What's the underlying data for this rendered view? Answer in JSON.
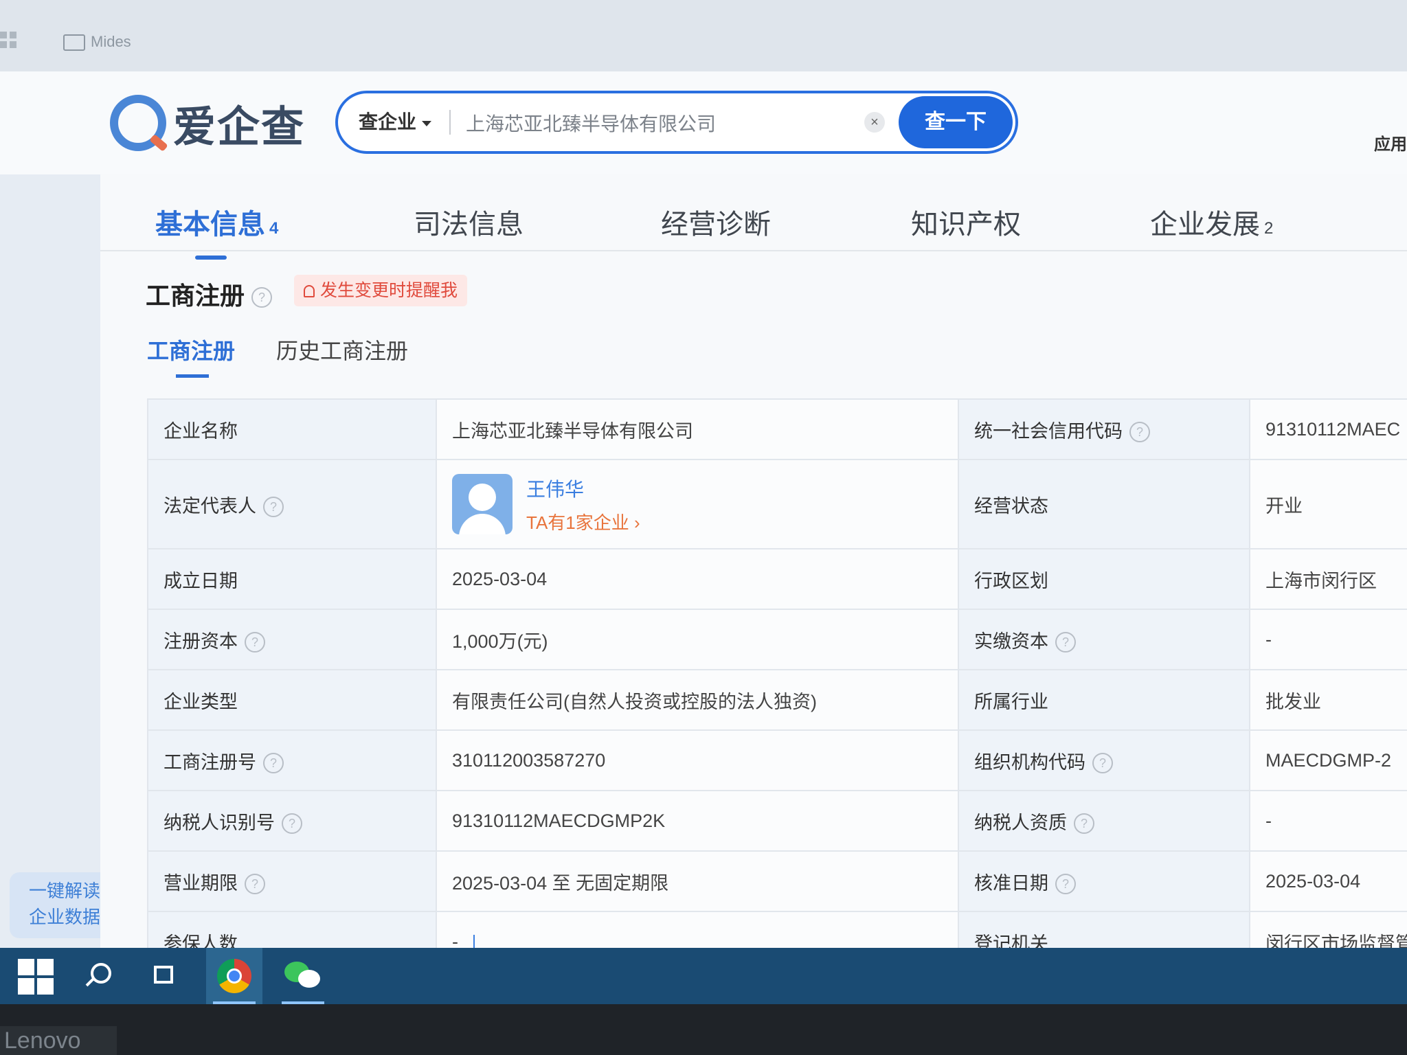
{
  "browser": {
    "bookmark_label": "Mides"
  },
  "header": {
    "logo_text": "爱企查",
    "search_type": "查企业",
    "search_value": "上海芯亚北臻半导体有限公司",
    "search_button": "查一下",
    "apply_label": "应用"
  },
  "tabs": [
    {
      "label": "基本信息",
      "count": "4"
    },
    {
      "label": "司法信息",
      "count": ""
    },
    {
      "label": "经营诊断",
      "count": ""
    },
    {
      "label": "知识产权",
      "count": ""
    },
    {
      "label": "企业发展",
      "count": "2"
    }
  ],
  "section": {
    "title": "工商注册",
    "remind": "发生变更时提醒我",
    "subtabs": [
      "工商注册",
      "历史工商注册"
    ]
  },
  "table": {
    "company_name": {
      "label": "企业名称",
      "value": "上海芯亚北臻半导体有限公司"
    },
    "credit_code": {
      "label": "统一社会信用代码",
      "value": "91310112MAEC"
    },
    "legal_rep": {
      "label": "法定代表人",
      "name": "王伟华",
      "count_text": "TA有1家企业 ›"
    },
    "status": {
      "label": "经营状态",
      "value": "开业"
    },
    "founded": {
      "label": "成立日期",
      "value": "2025-03-04"
    },
    "region": {
      "label": "行政区划",
      "value": "上海市闵行区"
    },
    "reg_capital": {
      "label": "注册资本",
      "value": "1,000万(元)"
    },
    "paid_capital": {
      "label": "实缴资本",
      "value": "-"
    },
    "company_type": {
      "label": "企业类型",
      "value": "有限责任公司(自然人投资或控股的法人独资)"
    },
    "industry": {
      "label": "所属行业",
      "value": "批发业"
    },
    "reg_number": {
      "label": "工商注册号",
      "value": "310112003587270"
    },
    "org_code": {
      "label": "组织机构代码",
      "value": "MAECDGMP-2"
    },
    "taxpayer_id": {
      "label": "纳税人识别号",
      "value": "91310112MAECDGMP2K"
    },
    "taxpayer_qual": {
      "label": "纳税人资质",
      "value": "-"
    },
    "term": {
      "label": "营业期限",
      "value": "2025-03-04 至 无固定期限"
    },
    "approval_date": {
      "label": "核准日期",
      "value": "2025-03-04"
    },
    "insured": {
      "label": "参保人数",
      "value": "-"
    },
    "authority": {
      "label": "登记机关",
      "value": "闵行区市场监督管理"
    }
  },
  "sidebar": {
    "ai_button_line1": "一键解读",
    "ai_button_line2": "企业数据"
  },
  "device": {
    "brand": "Lenovo"
  }
}
